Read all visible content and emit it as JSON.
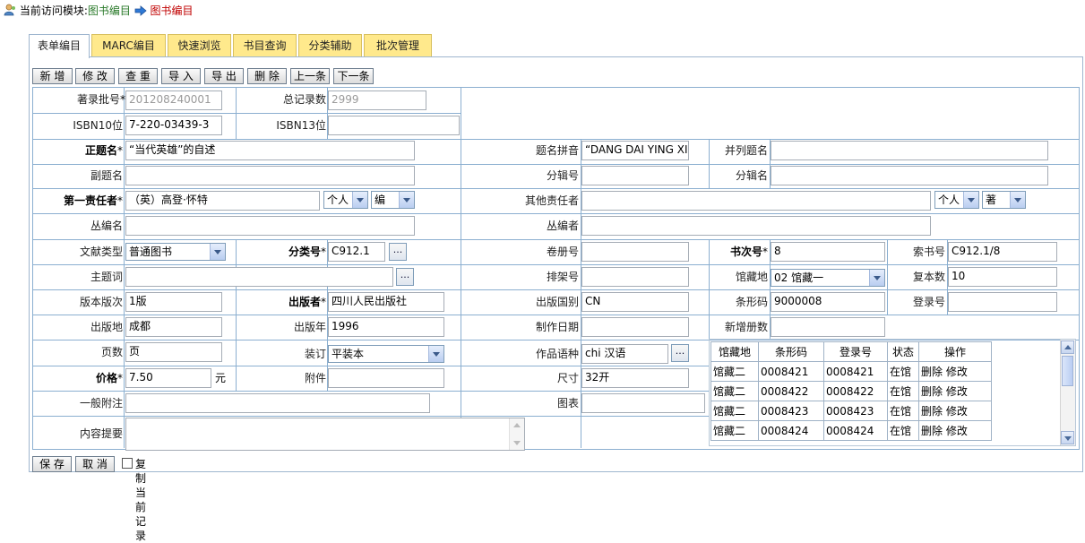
{
  "breadcrumb": {
    "prefix": "当前访问模块:",
    "module": "图书编目",
    "current": "图书编目"
  },
  "tabs": [
    "表单编目",
    "MARC编目",
    "快速浏览",
    "书目查询",
    "分类辅助",
    "批次管理"
  ],
  "toolbar": [
    "新 增",
    "修 改",
    "查 重",
    "导 入",
    "导 出",
    "删 除",
    "上一条",
    "下一条"
  ],
  "form": {
    "batch_no": {
      "label": "著录批号",
      "star": "*",
      "value": "201208240001"
    },
    "total": {
      "label": "总记录数",
      "value": "2999"
    },
    "isbn10": {
      "label": "ISBN10位",
      "value": "7-220-03439-3"
    },
    "isbn13": {
      "label": "ISBN13位",
      "value": ""
    },
    "title": {
      "label": "正题名",
      "star": "*",
      "value": "“当代英雄”的自述"
    },
    "pinyin": {
      "label": "题名拼音",
      "value": "“DANG DAI YING XIONG"
    },
    "parallel": {
      "label": "并列题名",
      "value": ""
    },
    "subtitle": {
      "label": "副题名",
      "value": ""
    },
    "part_no": {
      "label": "分辑号",
      "value": ""
    },
    "part_name": {
      "label": "分辑名",
      "value": ""
    },
    "author1": {
      "label": "第一责任者",
      "star": "*",
      "value": "（英）高登·怀特",
      "type": "个人",
      "role": "编"
    },
    "other_author": {
      "label": "其他责任者",
      "value": "",
      "type": "个人",
      "role": "著"
    },
    "series": {
      "label": "丛编名",
      "value": ""
    },
    "series_author": {
      "label": "丛编者",
      "value": ""
    },
    "doc_type": {
      "label": "文献类型",
      "value": "普通图书"
    },
    "class_no": {
      "label": "分类号",
      "star": "*",
      "value": "C912.1"
    },
    "volume": {
      "label": "卷册号",
      "value": ""
    },
    "book_no": {
      "label": "书次号",
      "star": "*",
      "value": "8"
    },
    "call_no": {
      "label": "索书号",
      "value": "C912.1/8"
    },
    "subject": {
      "label": "主题词",
      "value": ""
    },
    "shelf_no": {
      "label": "排架号",
      "value": ""
    },
    "location": {
      "label": "馆藏地",
      "value": "02 馆藏一"
    },
    "copies": {
      "label": "复本数",
      "value": "10"
    },
    "edition": {
      "label": "版本版次",
      "value": "1版"
    },
    "publisher": {
      "label": "出版者",
      "star": "*",
      "value": "四川人民出版社"
    },
    "pub_country": {
      "label": "出版国别",
      "value": "CN"
    },
    "barcode": {
      "label": "条形码",
      "value": "9000008"
    },
    "reg_no": {
      "label": "登录号",
      "value": ""
    },
    "pub_place": {
      "label": "出版地",
      "value": "成都"
    },
    "pub_year": {
      "label": "出版年",
      "value": "1996"
    },
    "made_date": {
      "label": "制作日期",
      "value": ""
    },
    "new_copies": {
      "label": "新增册数",
      "value": ""
    },
    "pages": {
      "label": "页数",
      "value": "页"
    },
    "binding": {
      "label": "装订",
      "value": "平装本"
    },
    "lang": {
      "label": "作品语种",
      "value": "chi 汉语"
    },
    "price": {
      "label": "价格",
      "star": "*",
      "value": "7.50",
      "unit": "元"
    },
    "attach": {
      "label": "附件",
      "value": ""
    },
    "size": {
      "label": "尺寸",
      "value": "32开"
    },
    "note": {
      "label": "一般附注",
      "value": ""
    },
    "chart": {
      "label": "图表",
      "value": ""
    },
    "summary": {
      "label": "内容提要",
      "value": ""
    }
  },
  "holdings": {
    "headers": [
      "馆藏地",
      "条形码",
      "登录号",
      "状态",
      "操作"
    ],
    "rows": [
      {
        "loc": "馆藏二",
        "barcode": "0008421",
        "reg": "0008421",
        "status": "在馆",
        "del": "删除",
        "edit": "修改"
      },
      {
        "loc": "馆藏二",
        "barcode": "0008422",
        "reg": "0008422",
        "status": "在馆",
        "del": "删除",
        "edit": "修改"
      },
      {
        "loc": "馆藏二",
        "barcode": "0008423",
        "reg": "0008423",
        "status": "在馆",
        "del": "删除",
        "edit": "修改"
      },
      {
        "loc": "馆藏二",
        "barcode": "0008424",
        "reg": "0008424",
        "status": "在馆",
        "del": "删除",
        "edit": "修改"
      }
    ]
  },
  "footer": {
    "save": "保 存",
    "cancel": "取 消",
    "copy_label": "复制当前记录"
  },
  "dots_label": "..."
}
